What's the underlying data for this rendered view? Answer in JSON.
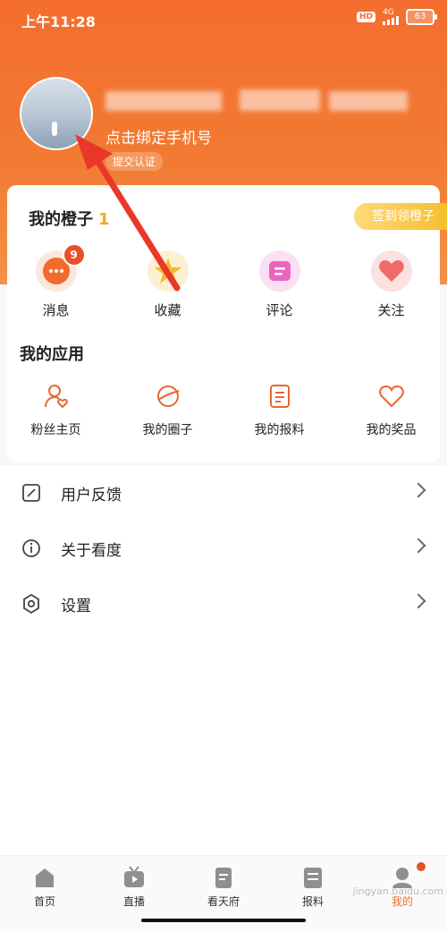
{
  "status_bar": {
    "time": "上午11:28",
    "hd": "HD",
    "network": "4G",
    "battery": "63"
  },
  "profile": {
    "phone_hint": "点击绑定手机号",
    "cert_label": "提交认证"
  },
  "orange_card": {
    "title": "我的橙子",
    "count": "1",
    "checkin_label": "签到领橙子"
  },
  "quick_actions": [
    {
      "label": "消息",
      "badge": "9",
      "icon": "message-icon",
      "color": "#f26b2e"
    },
    {
      "label": "收藏",
      "icon": "star-icon",
      "color": "#f5b72c"
    },
    {
      "label": "评论",
      "icon": "comment-icon",
      "color": "#e865c1"
    },
    {
      "label": "关注",
      "icon": "heart-icon",
      "color": "#f06a6a"
    }
  ],
  "my_apps": {
    "title": "我的应用",
    "items": [
      {
        "label": "粉丝主页",
        "icon": "user-heart-icon"
      },
      {
        "label": "我的圈子",
        "icon": "planet-icon"
      },
      {
        "label": "我的报料",
        "icon": "document-icon"
      },
      {
        "label": "我的奖品",
        "icon": "heart-outline-icon"
      }
    ]
  },
  "menu": [
    {
      "label": "用户反馈",
      "icon": "feedback-icon"
    },
    {
      "label": "关于看度",
      "icon": "info-icon"
    },
    {
      "label": "设置",
      "icon": "settings-icon"
    }
  ],
  "tabbar": [
    {
      "label": "首页",
      "icon": "home-icon"
    },
    {
      "label": "直播",
      "icon": "tv-icon"
    },
    {
      "label": "看天府",
      "icon": "news-icon"
    },
    {
      "label": "报料",
      "icon": "report-icon"
    },
    {
      "label": "我的",
      "icon": "profile-icon",
      "active": true
    }
  ],
  "watermark": "jingyan.baidu.com",
  "colors": {
    "accent": "#f46d2e",
    "gold": "#f5b72c"
  }
}
